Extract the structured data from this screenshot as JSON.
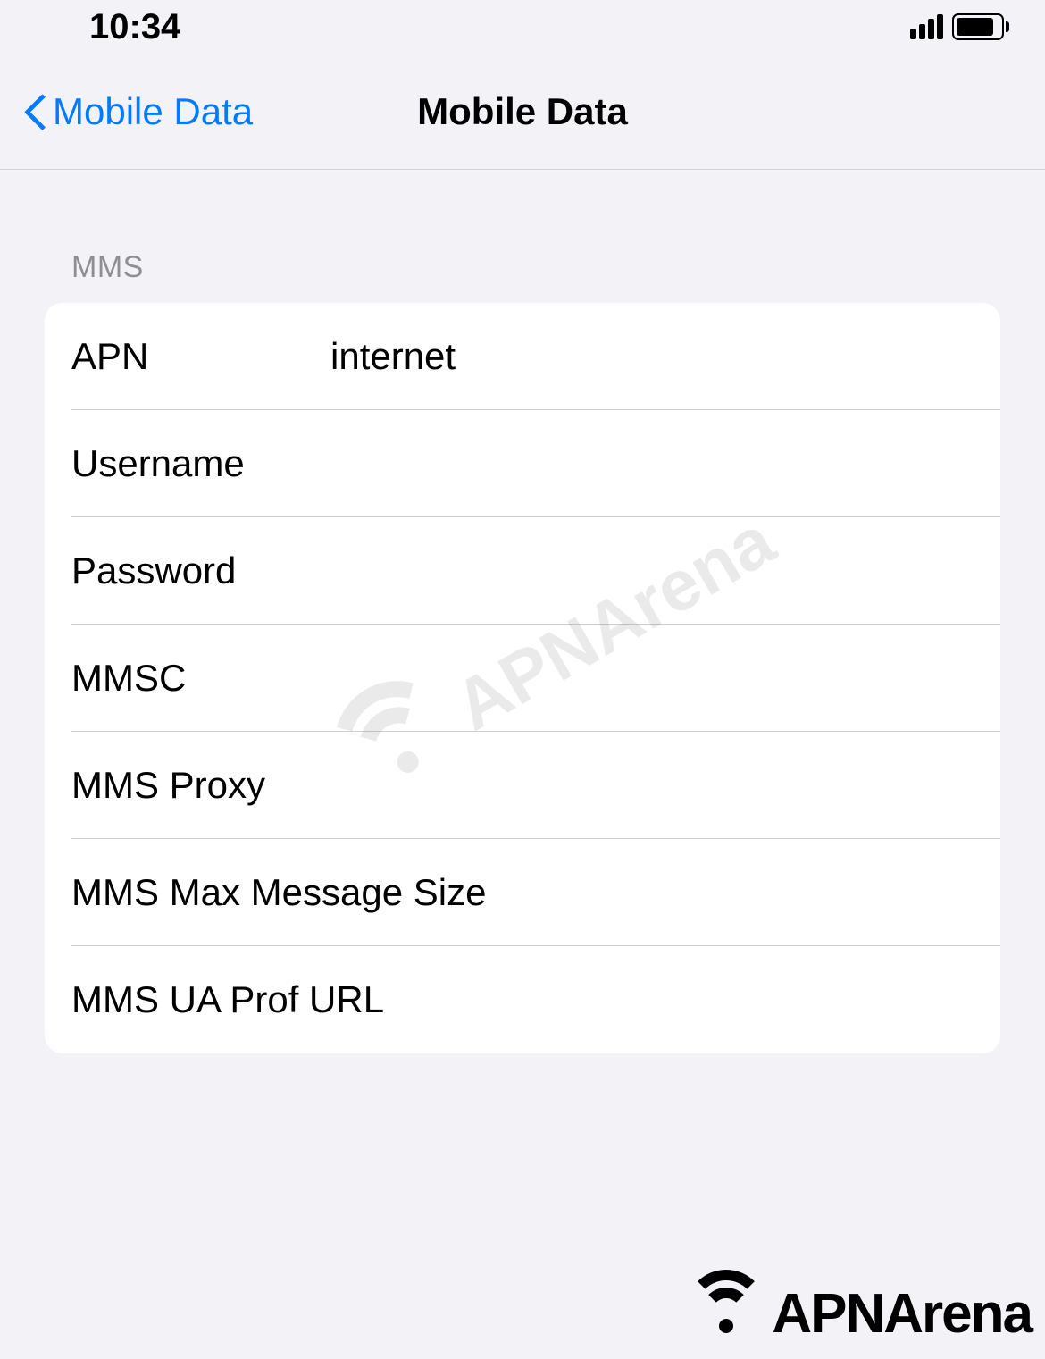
{
  "statusBar": {
    "time": "10:34"
  },
  "navBar": {
    "backLabel": "Mobile Data",
    "title": "Mobile Data"
  },
  "section": {
    "header": "MMS",
    "rows": [
      {
        "label": "APN",
        "value": "internet"
      },
      {
        "label": "Username",
        "value": ""
      },
      {
        "label": "Password",
        "value": ""
      },
      {
        "label": "MMSC",
        "value": ""
      },
      {
        "label": "MMS Proxy",
        "value": ""
      },
      {
        "label": "MMS Max Message Size",
        "value": ""
      },
      {
        "label": "MMS UA Prof URL",
        "value": ""
      }
    ]
  },
  "watermark": {
    "text": "APNArena"
  },
  "brand": {
    "text": "APNArena"
  }
}
